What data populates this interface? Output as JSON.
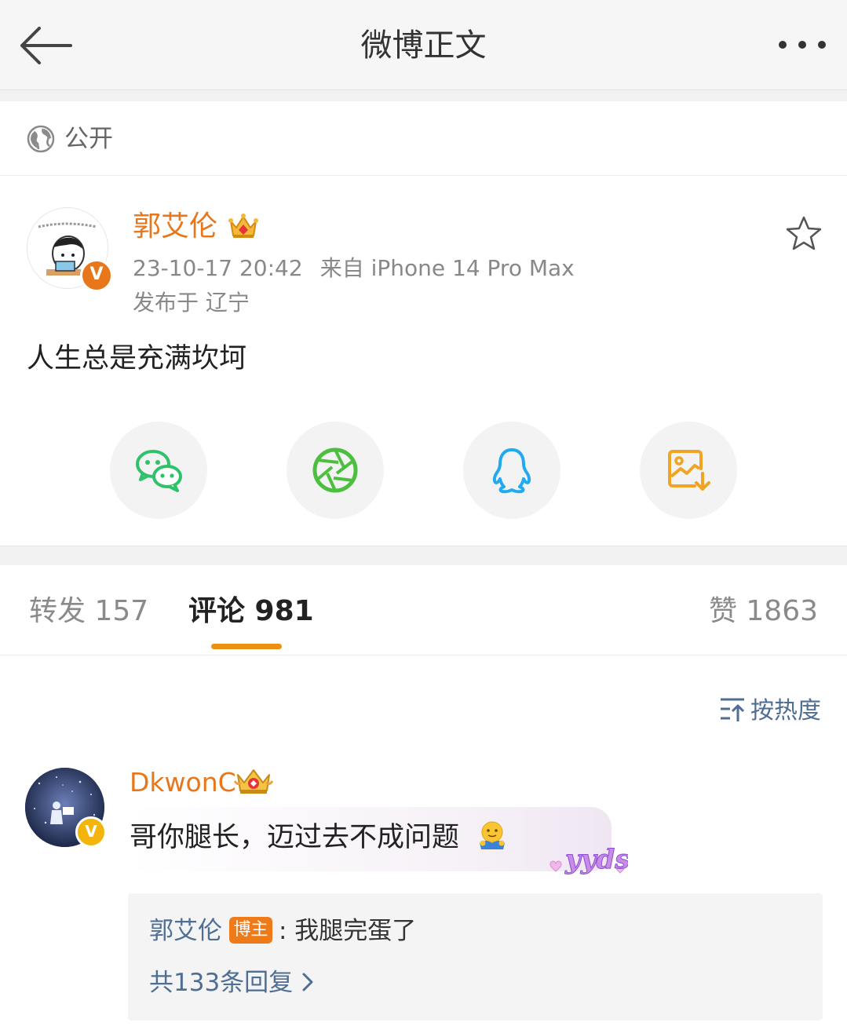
{
  "nav": {
    "title": "微博正文",
    "back_icon": "arrow-left-icon",
    "more_icon": "more-dots-icon"
  },
  "visibility": {
    "icon": "globe-icon",
    "label": "公开"
  },
  "post": {
    "author": "郭艾伦",
    "verified_badge": "V",
    "timestamp": "23-10-17 20:42",
    "source": "来自 iPhone 14 Pro Max",
    "location": "发布于 辽宁",
    "text": "人生总是充满坎坷",
    "favorite_icon": "star-outline-icon"
  },
  "share": [
    {
      "name": "wechat",
      "icon": "wechat-icon",
      "color": "#2fc26a"
    },
    {
      "name": "moments",
      "icon": "moments-aperture-icon",
      "color": "#4cbf3f"
    },
    {
      "name": "qq",
      "icon": "qq-penguin-icon",
      "color": "#22aaf0"
    },
    {
      "name": "save-image",
      "icon": "image-download-icon",
      "color": "#f0a422"
    }
  ],
  "tabs": {
    "repost": "转发 157",
    "comment": "评论 981",
    "like": "赞 1863",
    "active": "comment"
  },
  "sort": {
    "label": "按热度",
    "icon": "sort-icon"
  },
  "comments": [
    {
      "user": "DkwonC",
      "verified_badge": "V",
      "text": "哥你腿长，迈过去不成问题",
      "emoji": "hug-emoji-icon",
      "decoration": "yyds",
      "reply": {
        "author": "郭艾伦",
        "tag": "博主",
        "text": ": 我腿完蛋了",
        "more": "共133条回复"
      }
    }
  ],
  "colors": {
    "accent": "#e8761b",
    "link": "#4f6e93",
    "tab_indicator": "#ed8f12",
    "gold_badge": "#f3b40b"
  }
}
